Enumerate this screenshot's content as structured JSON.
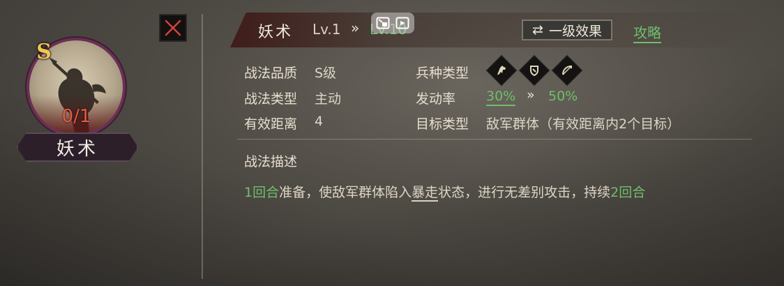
{
  "skill_card": {
    "grade": "S",
    "uses": "0/1",
    "name": "妖术"
  },
  "header": {
    "title": "妖术",
    "level": "Lv.1",
    "next_level": "Lv.10",
    "effect_button": "一级效果",
    "guide_link": "攻略"
  },
  "info": {
    "quality_label": "战法品质",
    "quality_value": "S级",
    "type_label": "战法类型",
    "type_value": "主动",
    "range_label": "有效距离",
    "range_value": "4",
    "troop_label": "兵种类型",
    "rate_label": "发动率",
    "rate_current": "30%",
    "rate_max": "50%",
    "target_label": "目标类型",
    "target_value": "敌军群体（有效距离内2个目标）"
  },
  "troop_icons": [
    "cavalry-icon",
    "shield-icon",
    "bow-icon"
  ],
  "description": {
    "title": "战法描述",
    "p1": "1回合",
    "p2": "准备，使敌军群体陷入",
    "p3": "暴走",
    "p4": "状态，进行无差别攻击，持续",
    "p5": "2回合"
  },
  "colors": {
    "accent_green": "#6fbf6a",
    "grade_gold": "#f1c64f",
    "uses_red": "#e8593f"
  }
}
